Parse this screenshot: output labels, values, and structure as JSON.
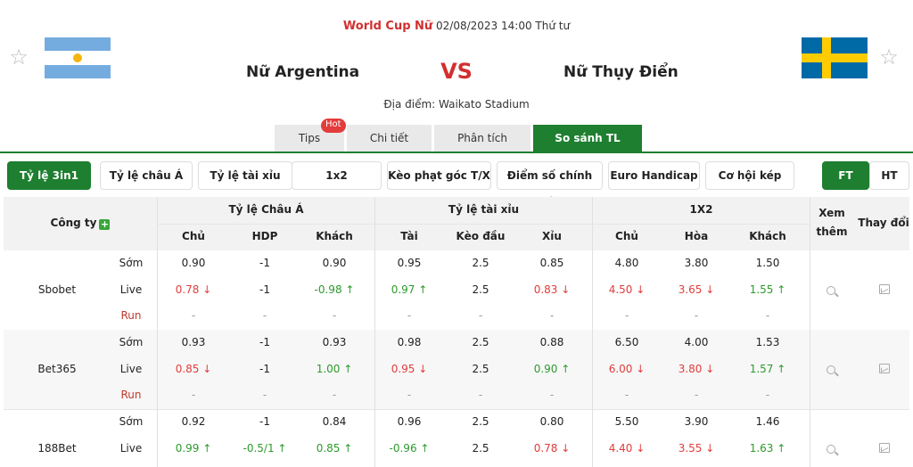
{
  "header": {
    "league": "World Cup Nữ",
    "datetime": "02/08/2023 14:00 Thứ tư",
    "home_team": "Nữ Argentina",
    "away_team": "Nữ Thụy Điển",
    "vs": "VS",
    "venue": "Địa điểm: Waikato Stadium",
    "star_icon": "☆"
  },
  "tabs": [
    {
      "label": "Tips",
      "badge": "Hot"
    },
    {
      "label": "Chi tiết"
    },
    {
      "label": "Phân tích"
    },
    {
      "label": "So sánh TL",
      "active": true
    }
  ],
  "filters": [
    "Tỷ lệ 3in1",
    "Tỷ lệ châu Á",
    "Tỷ lệ tài xỉu",
    "1x2",
    "Kèo phạt góc T/X",
    "Điểm số chính xác",
    "Euro Handicap",
    "Cơ hội kép"
  ],
  "period_toggle": [
    "FT",
    "HT"
  ],
  "table": {
    "company_header": "Công ty",
    "group_headers": [
      "Tỷ lệ Châu Á",
      "Tỷ lệ tài xỉu",
      "1X2"
    ],
    "view_more": "Xem thêm",
    "change": "Thay đổi",
    "sub_headers": [
      "Chủ",
      "HDP",
      "Khách",
      "Tài",
      "Kèo đầu",
      "Xỉu",
      "Chủ",
      "Hòa",
      "Khách"
    ],
    "row_types": [
      "Sớm",
      "Live",
      "Run"
    ],
    "companies": [
      {
        "name": "Sbobet",
        "rows": [
          [
            [
              "0.90",
              ""
            ],
            [
              "-1",
              ""
            ],
            [
              "0.90",
              ""
            ],
            [
              "0.95",
              ""
            ],
            [
              "2.5",
              ""
            ],
            [
              "0.85",
              ""
            ],
            [
              "4.80",
              ""
            ],
            [
              "3.80",
              ""
            ],
            [
              "1.50",
              ""
            ]
          ],
          [
            [
              "0.78 ↓",
              "down"
            ],
            [
              "-1",
              ""
            ],
            [
              "-0.98 ↑",
              "up"
            ],
            [
              "0.97 ↑",
              "up"
            ],
            [
              "2.5",
              ""
            ],
            [
              "0.83 ↓",
              "down"
            ],
            [
              "4.50 ↓",
              "down"
            ],
            [
              "3.65 ↓",
              "down"
            ],
            [
              "1.55 ↑",
              "up"
            ]
          ],
          [
            [
              "-",
              "dash"
            ],
            [
              "-",
              "dash"
            ],
            [
              "-",
              "dash"
            ],
            [
              "-",
              "dash"
            ],
            [
              "-",
              "dash"
            ],
            [
              "-",
              "dash"
            ],
            [
              "-",
              "dash"
            ],
            [
              "-",
              "dash"
            ],
            [
              "-",
              "dash"
            ]
          ]
        ]
      },
      {
        "name": "Bet365",
        "rows": [
          [
            [
              "0.93",
              ""
            ],
            [
              "-1",
              ""
            ],
            [
              "0.93",
              ""
            ],
            [
              "0.98",
              ""
            ],
            [
              "2.5",
              ""
            ],
            [
              "0.88",
              ""
            ],
            [
              "6.50",
              ""
            ],
            [
              "4.00",
              ""
            ],
            [
              "1.53",
              ""
            ]
          ],
          [
            [
              "0.85 ↓",
              "down"
            ],
            [
              "-1",
              ""
            ],
            [
              "1.00 ↑",
              "up"
            ],
            [
              "0.95 ↓",
              "down"
            ],
            [
              "2.5",
              ""
            ],
            [
              "0.90 ↑",
              "up"
            ],
            [
              "6.00 ↓",
              "down"
            ],
            [
              "3.80 ↓",
              "down"
            ],
            [
              "1.57 ↑",
              "up"
            ]
          ],
          [
            [
              "-",
              "dash"
            ],
            [
              "-",
              "dash"
            ],
            [
              "-",
              "dash"
            ],
            [
              "-",
              "dash"
            ],
            [
              "-",
              "dash"
            ],
            [
              "-",
              "dash"
            ],
            [
              "-",
              "dash"
            ],
            [
              "-",
              "dash"
            ],
            [
              "-",
              "dash"
            ]
          ]
        ]
      },
      {
        "name": "188Bet",
        "rows": [
          [
            [
              "0.92",
              ""
            ],
            [
              "-1",
              ""
            ],
            [
              "0.84",
              ""
            ],
            [
              "0.96",
              ""
            ],
            [
              "2.5",
              ""
            ],
            [
              "0.80",
              ""
            ],
            [
              "5.50",
              ""
            ],
            [
              "3.90",
              ""
            ],
            [
              "1.46",
              ""
            ]
          ],
          [
            [
              "0.99 ↑",
              "up"
            ],
            [
              "-0.5/1 ↑",
              "up"
            ],
            [
              "0.85 ↑",
              "up"
            ],
            [
              "-0.96 ↑",
              "up"
            ],
            [
              "2.5",
              ""
            ],
            [
              "0.78 ↓",
              "down"
            ],
            [
              "4.40 ↓",
              "down"
            ],
            [
              "3.55 ↓",
              "down"
            ],
            [
              "1.63 ↑",
              "up"
            ]
          ]
        ]
      }
    ]
  },
  "colors": {
    "accent": "#1d7f2f",
    "up": "#2e9a2e",
    "down": "#e23c3c",
    "league": "#d22f2f"
  }
}
